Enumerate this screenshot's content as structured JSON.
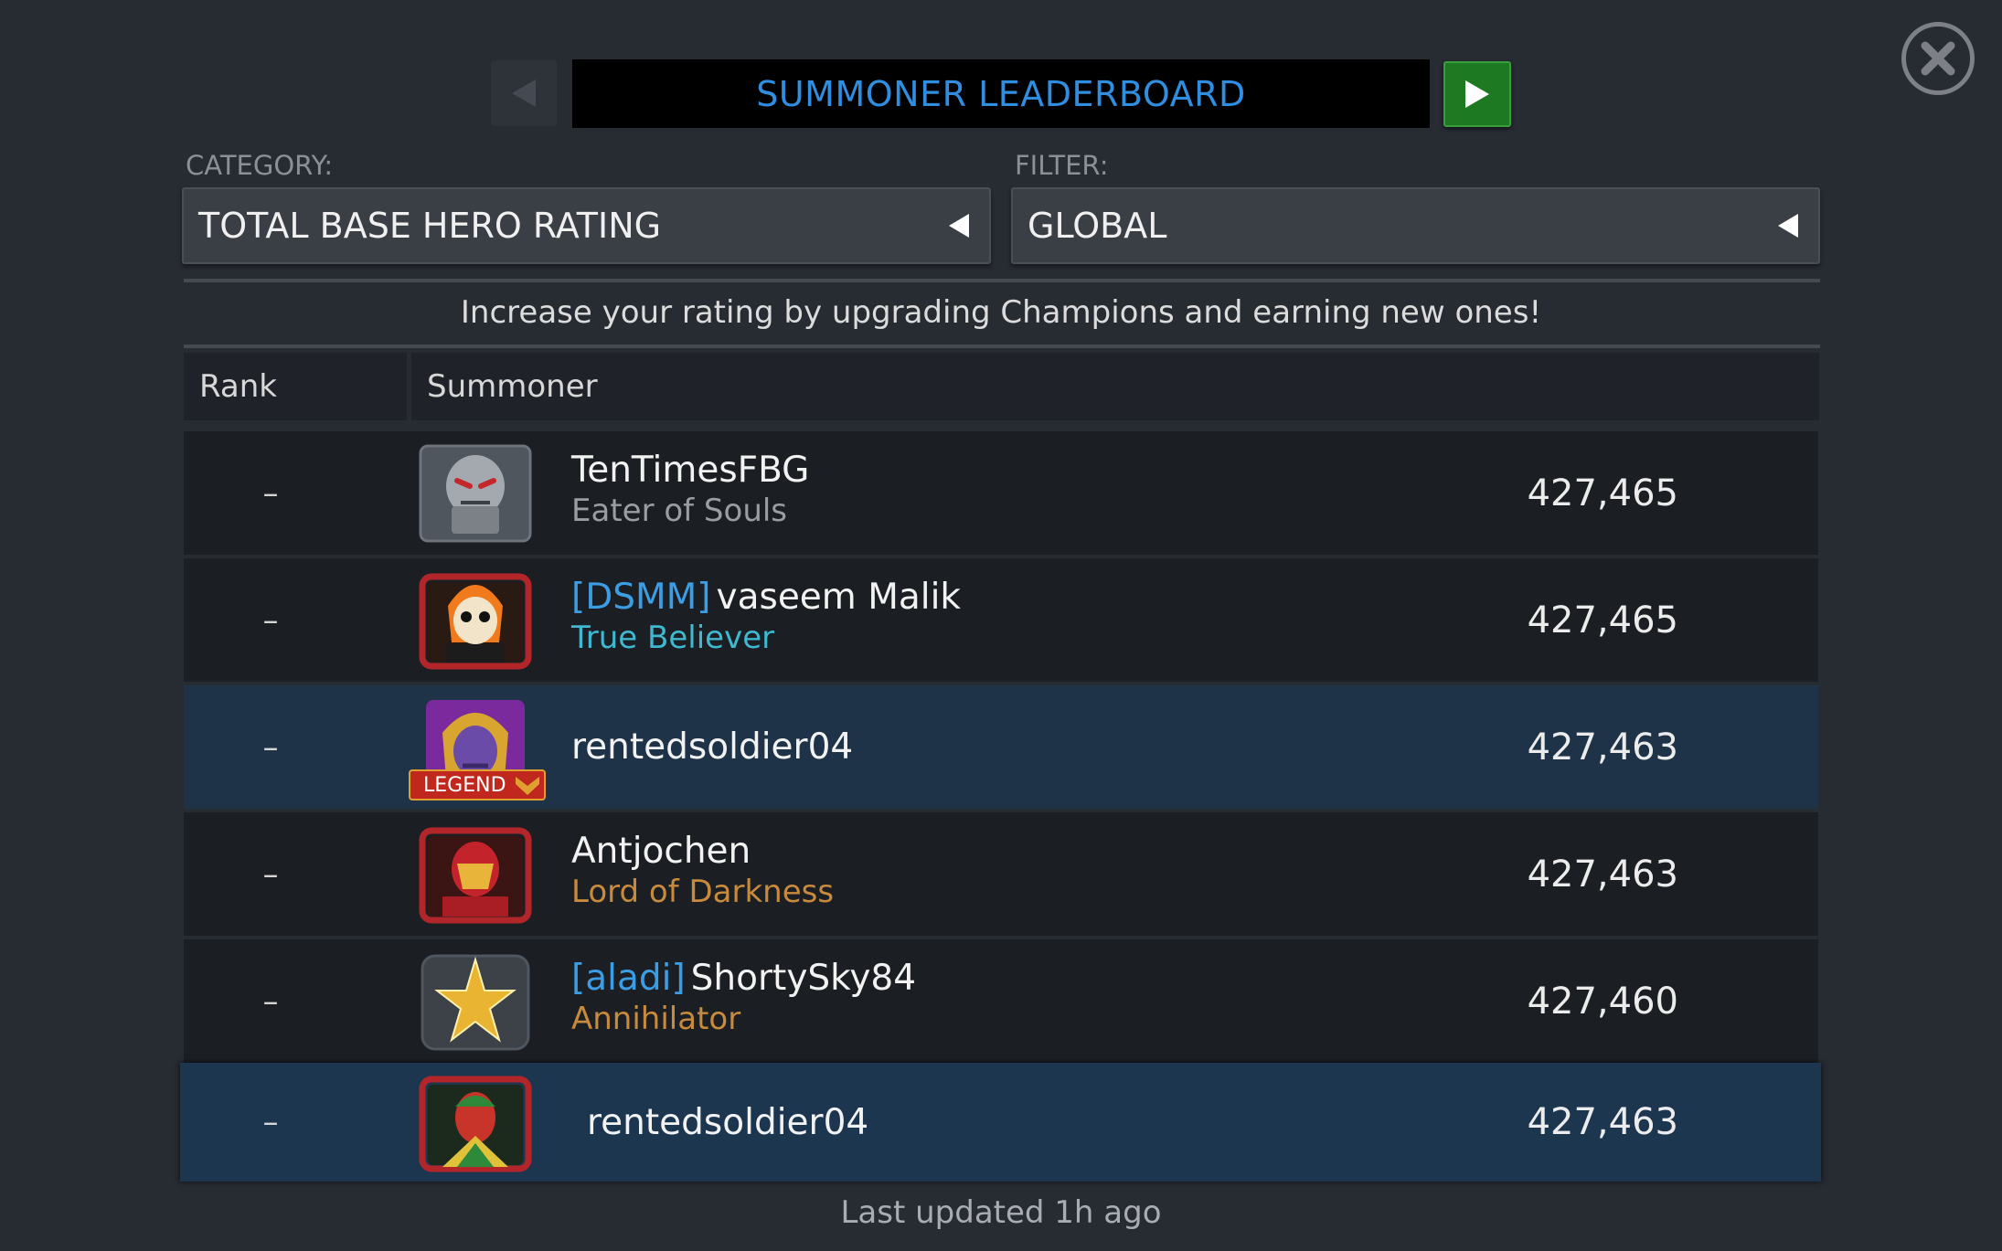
{
  "header": {
    "title": "SUMMONER LEADERBOARD",
    "prev_icon": "triangle-left",
    "next_icon": "triangle-right",
    "close_icon": "x-circle"
  },
  "category": {
    "label": "CATEGORY:",
    "value": "TOTAL BASE HERO RATING"
  },
  "filter": {
    "label": "FILTER:",
    "value": "GLOBAL"
  },
  "hint": "Increase your rating by upgrading Champions and earning new ones!",
  "columns": {
    "rank": "Rank",
    "summoner": "Summoner"
  },
  "rows": [
    {
      "rank": "–",
      "alliance": "",
      "name": "TenTimesFBG",
      "title": "Eater of Souls",
      "title_color": "#9a9ea3",
      "score": "427,465",
      "avatar": "ultron"
    },
    {
      "rank": "–",
      "alliance": "[DSMM]",
      "name": "vaseem Malik",
      "title": "True Believer",
      "title_color": "#3fb8d0",
      "score": "427,465",
      "avatar": "ghost-rider"
    },
    {
      "rank": "–",
      "alliance": "",
      "name": "rentedsoldier04",
      "title": "",
      "score": "427,463",
      "avatar": "thanos",
      "badge": "LEGEND",
      "highlight": true
    },
    {
      "rank": "–",
      "alliance": "",
      "name": "Antjochen",
      "title": "Lord of Darkness",
      "title_color": "#c88a3c",
      "score": "427,463",
      "avatar": "iron-man"
    },
    {
      "rank": "–",
      "alliance": "[aladi]",
      "name": "ShortySky84",
      "title": "Annihilator",
      "title_color": "#c88a3c",
      "score": "427,460",
      "avatar": "star-emblem"
    }
  ],
  "self_row": {
    "rank": "–",
    "name": "rentedsoldier04",
    "score": "427,463",
    "avatar": "vision"
  },
  "footer": "Last updated 1h ago",
  "colors": {
    "accent": "#2f8ee0",
    "next_button": "#1e7a22",
    "highlight_row": "#1e3348"
  }
}
